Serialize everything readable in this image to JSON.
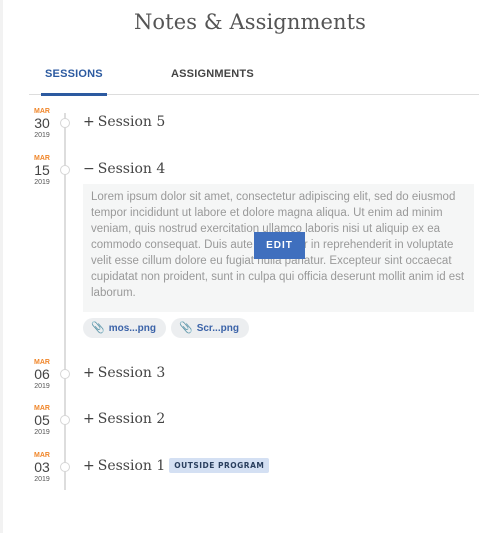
{
  "page": {
    "title": "Notes & Assignments"
  },
  "tabs": [
    {
      "label": "SESSIONS",
      "active": true
    },
    {
      "label": "ASSIGNMENTS",
      "active": false
    }
  ],
  "colors": {
    "accent": "#2c5aa0",
    "date_month": "#f0862a",
    "edit_button": "#3f6fbe",
    "badge_bg": "#d4e0f3"
  },
  "sessions": [
    {
      "month": "MAR",
      "day": "30",
      "year": "2019",
      "sign": "+",
      "title": "Session 5",
      "expanded": false
    },
    {
      "month": "MAR",
      "day": "15",
      "year": "2019",
      "sign": "−",
      "title": "Session 4",
      "expanded": true,
      "notes": "Lorem ipsum dolor sit amet, consectetur adipiscing elit, sed do eiusmod tempor incididunt ut labore et dolore magna aliqua. Ut enim ad minim veniam, quis nostrud exercitation ullamco laboris nisi ut aliquip ex ea commodo consequat. Duis aute irure dolor in reprehenderit in voluptate velit esse cillum dolore eu fugiat nulla pariatur. Excepteur sint occaecat cupidatat non proident, sunt in culpa qui officia deserunt mollit anim id est laborum.",
      "edit_label": "EDIT",
      "attachments": [
        {
          "icon": "paperclip-icon",
          "name": "mos...png"
        },
        {
          "icon": "paperclip-icon",
          "name": "Scr...png"
        }
      ]
    },
    {
      "month": "MAR",
      "day": "06",
      "year": "2019",
      "sign": "+",
      "title": "Session 3",
      "expanded": false
    },
    {
      "month": "MAR",
      "day": "05",
      "year": "2019",
      "sign": "+",
      "title": "Session 2",
      "expanded": false
    },
    {
      "month": "MAR",
      "day": "03",
      "year": "2019",
      "sign": "+",
      "title": "Session 1",
      "expanded": false,
      "badge": "OUTSIDE PROGRAM"
    }
  ]
}
